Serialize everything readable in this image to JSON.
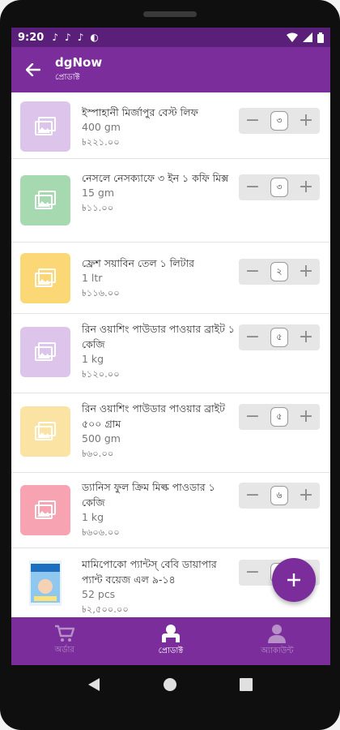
{
  "status_bar": {
    "time": "9:20",
    "notifications": [
      "♪",
      "♪",
      "♪",
      "◐"
    ]
  },
  "app_bar": {
    "title": "dgNow",
    "subtitle": "প্রোডাক্ট"
  },
  "products": [
    {
      "name": "ইস্পাহানী মির্জাপুর বেস্ট লিফ",
      "unit": "400 gm",
      "price": "৳২২১.০০",
      "qty": "৩",
      "thumb_color": "#dcc4ea"
    },
    {
      "name": "নেসলে নেসক্যাফে ৩ ইন ১ কফি মিক্স",
      "unit": "15 gm",
      "price": "৳১১.০০",
      "qty": "৩",
      "thumb_color": "#a7d9b0"
    },
    {
      "name": "ফ্রেশ সয়াবিন তেল ১ লিটার",
      "unit": "1 ltr",
      "price": "৳১১৬.০০",
      "qty": "২",
      "thumb_color": "#fbd776"
    },
    {
      "name": "রিন ওয়াশিং পাউডার পাওয়ার ব্রাইট ১ কেজি",
      "unit": "1 kg",
      "price": "৳১২০.০০",
      "qty": "৫",
      "thumb_color": "#dcc4ea"
    },
    {
      "name": "রিন ওয়াশিং পাউডার পাওয়ার ব্রাইট ৫০০ গ্রাম",
      "unit": "500 gm",
      "price": "৳৬০.০০",
      "qty": "৫",
      "thumb_color": "#fbe3a4"
    },
    {
      "name": "ড্যানিস ফুল ক্রিম মিল্ক পাওডার ১ কেজি",
      "unit": "1 kg",
      "price": "৳৬০৬.০০",
      "qty": "৬",
      "thumb_color": "#f7a3b2"
    },
    {
      "name": "মামিপোকো প্যান্টস্ বেবি ডায়াপার প্যান্ট বয়েজ এল ৯-১৪",
      "unit": "52 pcs",
      "price": "৳২,৫০০.০০",
      "qty": "",
      "thumb_color": "#ffffff"
    }
  ],
  "fab": {
    "label": "+"
  },
  "bottom_nav": [
    {
      "label": "অর্ডার",
      "icon": "cart-icon",
      "active": false
    },
    {
      "label": "প্রোডাক্ট",
      "icon": "product-icon",
      "active": true
    },
    {
      "label": "অ্যাকাউন্ট",
      "icon": "account-icon",
      "active": false
    }
  ],
  "colors": {
    "primary": "#7b2d9c",
    "status_bar": "#5a1f78"
  }
}
